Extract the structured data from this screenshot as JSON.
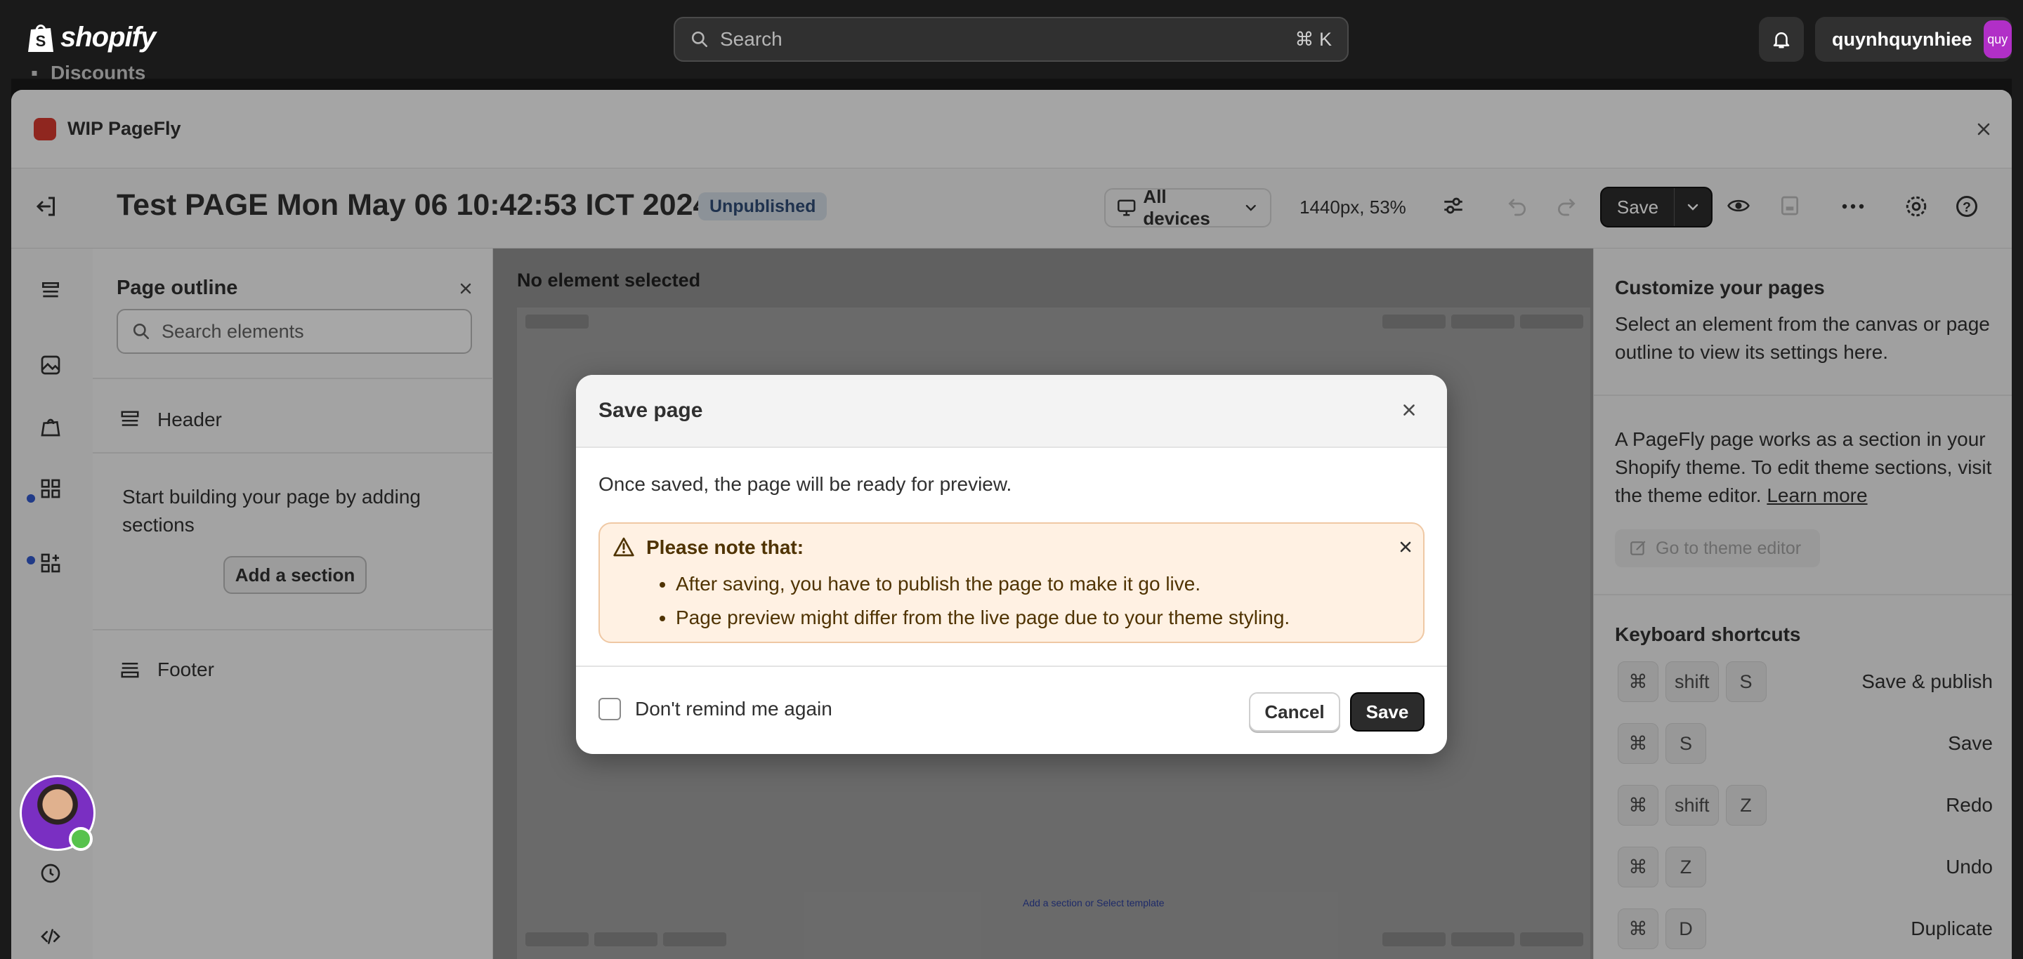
{
  "shopify": {
    "logo_text": "shopify",
    "search_placeholder": "Search",
    "search_shortcut": "⌘ K",
    "user_name": "quynhquynhiee",
    "user_avatar_text": "quy",
    "behind_nav_item": "Discounts"
  },
  "app": {
    "title": "WIP PageFly"
  },
  "pagefly_header": {
    "page_title": "Test PAGE Mon May 06 10:42:53 ICT 2024",
    "status_badge": "Unpublished",
    "devices_label": "All devices",
    "zoom_text": "1440px, 53%",
    "save_label": "Save"
  },
  "outline": {
    "title": "Page outline",
    "search_placeholder": "Search elements",
    "header_label": "Header",
    "start_text": "Start building your page by adding sections",
    "add_section_label": "Add a section",
    "footer_label": "Footer"
  },
  "canvas": {
    "no_selected": "No element selected",
    "link_text": "Add a section or Select template"
  },
  "right_panel": {
    "title": "Customize your pages",
    "description": "Select an element from the canvas or page outline to view its settings here.",
    "description2": "A PageFly page works as a section in your Shopify theme. To edit theme sections, visit the theme editor.",
    "learn_more": "Learn more",
    "theme_editor_button": "Go to theme editor",
    "shortcuts_title": "Keyboard shortcuts",
    "shortcuts": [
      {
        "keys": [
          "⌘",
          "shift",
          "S"
        ],
        "label": "Save & publish"
      },
      {
        "keys": [
          "⌘",
          "S"
        ],
        "label": "Save"
      },
      {
        "keys": [
          "⌘",
          "shift",
          "Z"
        ],
        "label": "Redo"
      },
      {
        "keys": [
          "⌘",
          "Z"
        ],
        "label": "Undo"
      },
      {
        "keys": [
          "⌘",
          "D"
        ],
        "label": "Duplicate"
      }
    ]
  },
  "dialog": {
    "title": "Save page",
    "body": "Once saved, the page will be ready for preview.",
    "note_title": "Please note that:",
    "note_items": [
      "After saving, you have to publish the page to make it go live.",
      "Page preview might differ from the live page due to your theme styling."
    ],
    "checkbox_label": "Don't remind me again",
    "checkbox_checked": false,
    "cancel_label": "Cancel",
    "save_label": "Save"
  },
  "colors": {
    "topbar": "#1a1a1a",
    "note_bg": "#fff1e3",
    "primary_button": "#2b2b2b",
    "status_badge_bg": "#cfd7e0",
    "online": "#57c24d"
  }
}
